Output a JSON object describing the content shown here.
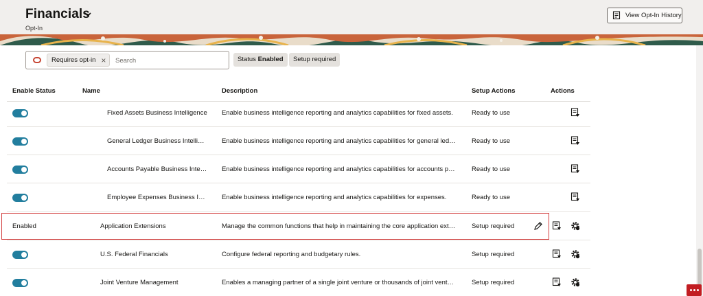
{
  "header": {
    "title": "Financials",
    "subtitle": "Opt-In",
    "history_button": "View Opt-In History"
  },
  "search": {
    "chip_label": "Requires opt-in",
    "chip_close": "×",
    "placeholder": "Search"
  },
  "facets": {
    "status_label": "Status",
    "status_value": "Enabled",
    "setup_required": "Setup required"
  },
  "columns": {
    "enable_status": "Enable Status",
    "name": "Name",
    "description": "Description",
    "setup_actions": "Setup Actions",
    "actions": "Actions"
  },
  "rows": [
    {
      "status": "toggle-on",
      "name": "Fixed Assets Business Intelligence",
      "description": "Enable business intelligence reporting and analytics capabilities for fixed assets.",
      "setup": "Ready to use"
    },
    {
      "status": "toggle-on",
      "name": "General Ledger Business Intelligence",
      "description": "Enable business intelligence reporting and analytics capabilities for general ledger.",
      "setup": "Ready to use"
    },
    {
      "status": "toggle-on",
      "name": "Accounts Payable Business Intelligence",
      "description": "Enable business intelligence reporting and analytics capabilities for accounts payable.",
      "setup": "Ready to use"
    },
    {
      "status": "toggle-on",
      "name": "Employee Expenses Business Intelligence",
      "description": "Enable business intelligence reporting and analytics capabilities for expenses.",
      "setup": "Ready to use"
    },
    {
      "status": "Enabled",
      "name": "Application Extensions",
      "description": "Manage the common functions that help in maintaining the core application extensions.",
      "setup": "Setup required"
    },
    {
      "status": "toggle-on",
      "name": "U.S. Federal Financials",
      "description": "Configure federal reporting and budgetary rules.",
      "setup": "Setup required"
    },
    {
      "status": "toggle-on",
      "name": "Joint Venture Management",
      "description": "Enables a managing partner of a single joint venture or thousands of joint ventures.",
      "setup": "Setup required"
    }
  ],
  "colors": {
    "toggle_on": "#227e9e",
    "highlight": "#d23c3c",
    "accent_red": "#c74634",
    "feedback": "#c21d22"
  },
  "icons": {
    "title_menu": "chevron-down-icon",
    "history": "history-report-icon",
    "chip": "search-oval-icon",
    "row_actions": [
      "report-icon",
      "gear-icon",
      "pencil-icon"
    ],
    "feedback": "more-icon"
  }
}
